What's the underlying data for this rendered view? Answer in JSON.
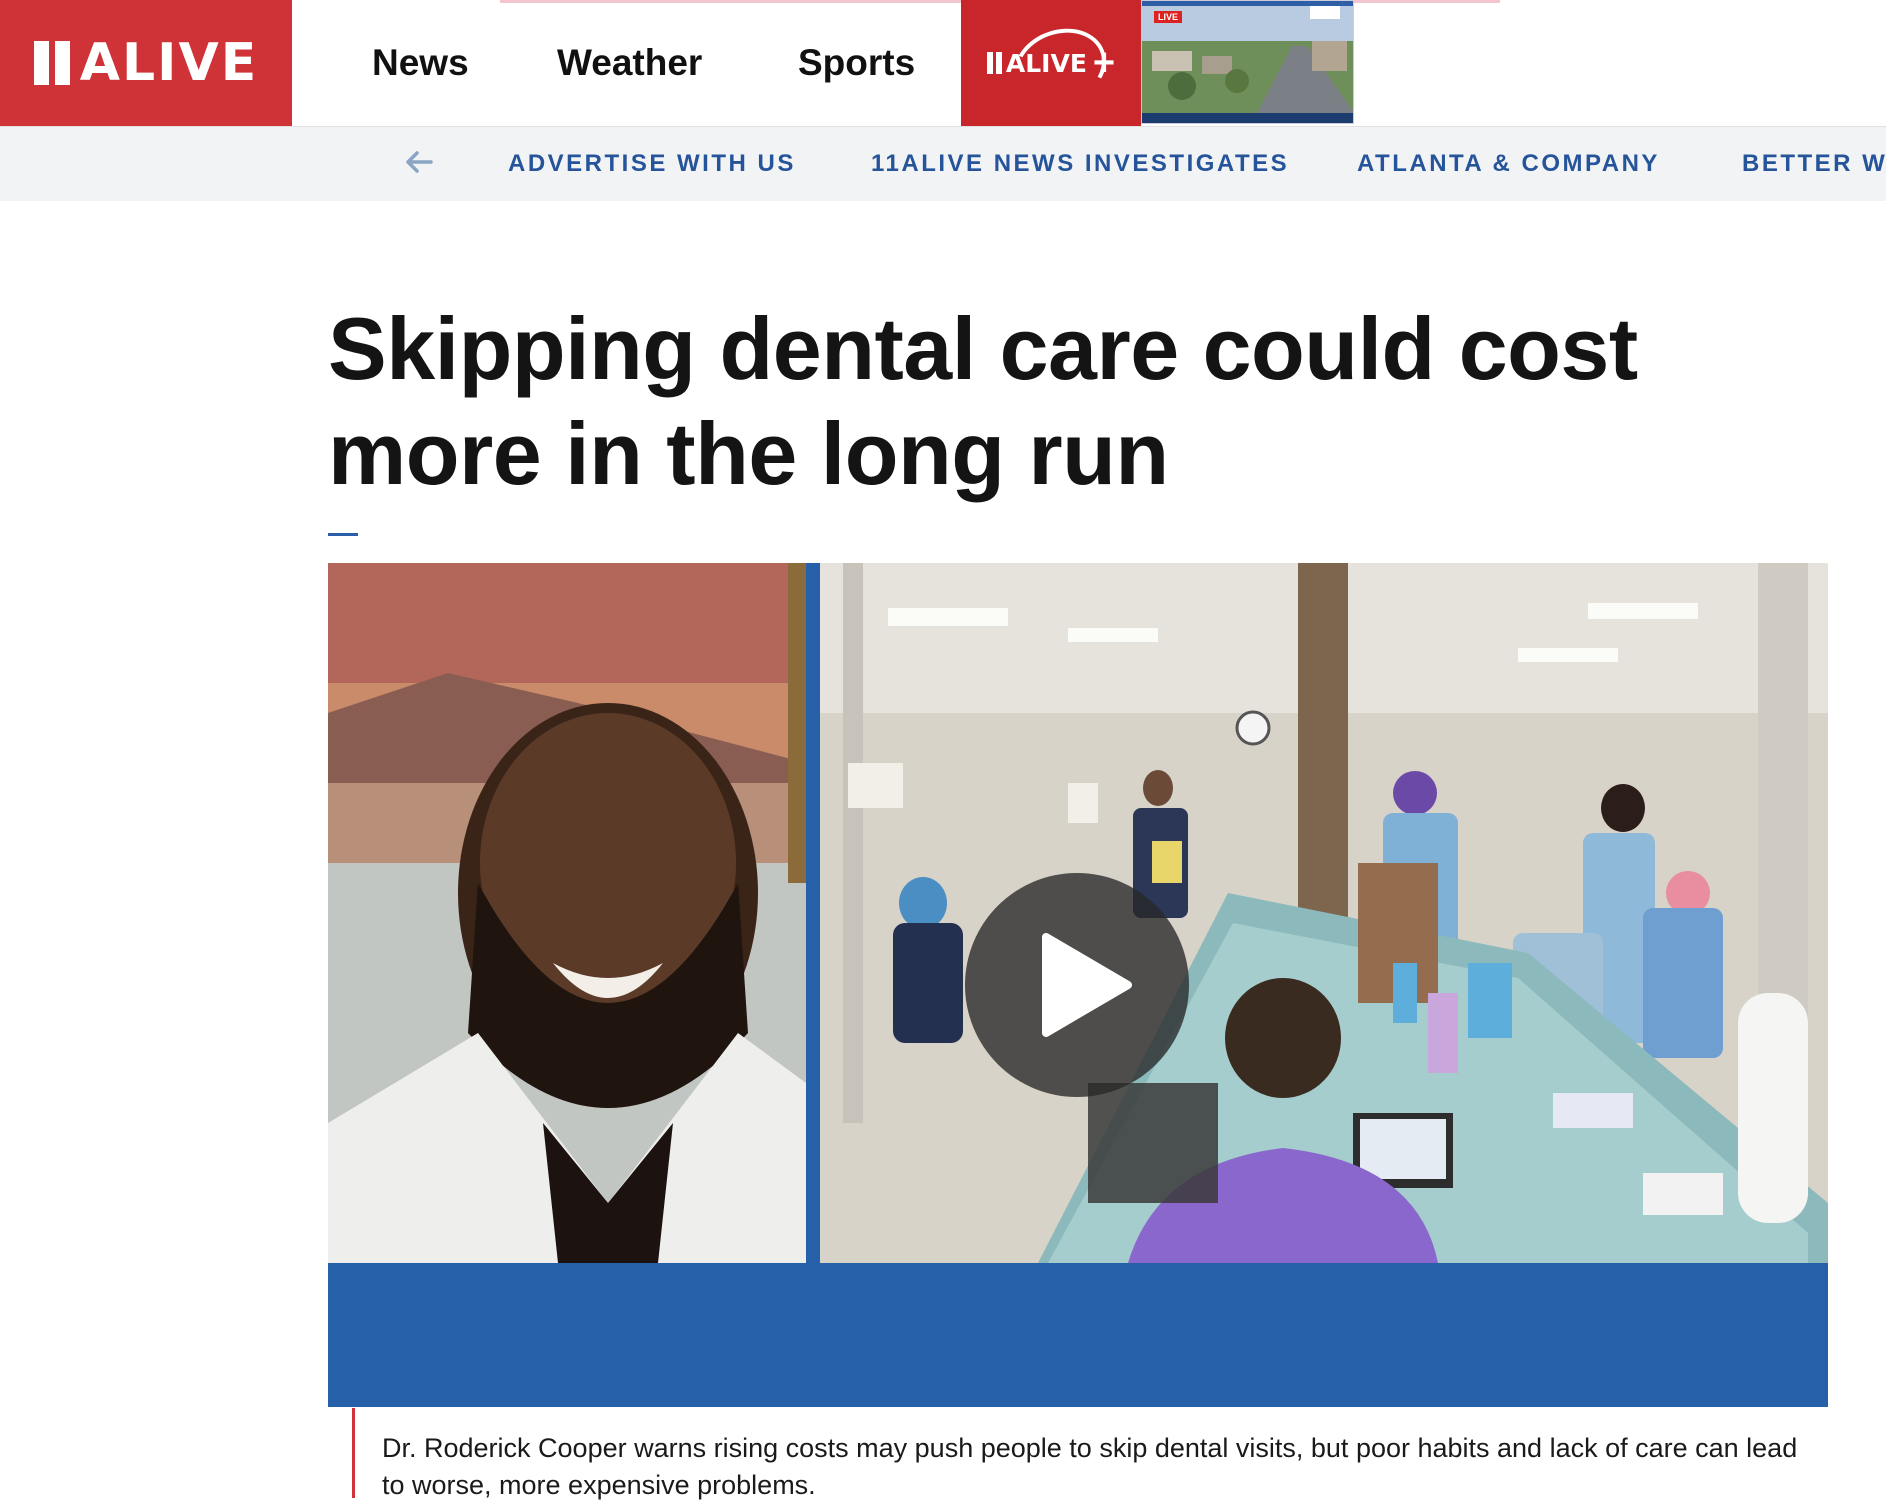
{
  "header": {
    "logo_text": "ALIVE",
    "nav": [
      "News",
      "Weather",
      "Sports"
    ],
    "plus_text": "ALIVE",
    "plus_sign": "+",
    "live_badge": "LIVE"
  },
  "subnav": {
    "items": [
      "ADVERTISE WITH US",
      "11ALIVE NEWS INVESTIGATES",
      "ATLANTA & COMPANY",
      "BETTER WO"
    ]
  },
  "article": {
    "headline": "Skipping dental care could cost more in the long run",
    "caption": "Dr. Roderick Cooper warns rising costs may push people to skip dental visits, but poor habits and lack of care can lead to worse, more expensive problems."
  },
  "colors": {
    "brand_red": "#cf3338",
    "plus_red": "#c8262b",
    "nav_blue": "#25549a",
    "video_blue": "#2660a8"
  },
  "icons": {
    "back_arrow": "left-arrow-icon",
    "play": "play-icon"
  }
}
